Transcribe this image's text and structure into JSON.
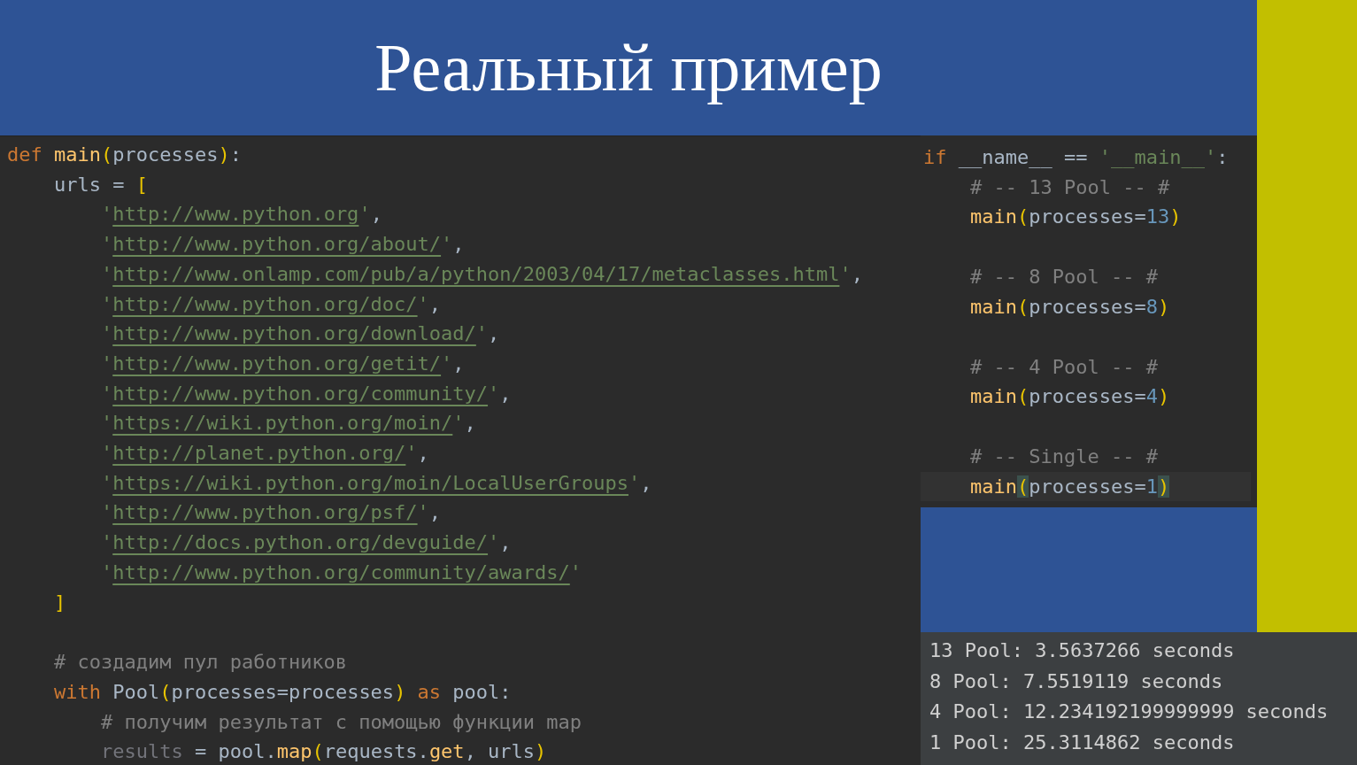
{
  "title": "Реальный пример",
  "main_code": [
    {
      "tokens": [
        {
          "kind": "keyword",
          "text": "def "
        },
        {
          "kind": "func",
          "text": "main"
        },
        {
          "kind": "bracket",
          "text": "("
        },
        {
          "kind": "plain",
          "text": "processes"
        },
        {
          "kind": "bracket",
          "text": ")"
        },
        {
          "kind": "plain",
          "text": ":"
        }
      ]
    },
    {
      "tokens": [
        {
          "kind": "plain",
          "text": "    urls = "
        },
        {
          "kind": "bracket",
          "text": "["
        }
      ]
    },
    {
      "tokens": [
        {
          "kind": "string",
          "text": "        '"
        },
        {
          "kind": "url",
          "text": "http://www.python.org"
        },
        {
          "kind": "string",
          "text": "'"
        },
        {
          "kind": "plain",
          "text": ","
        }
      ]
    },
    {
      "tokens": [
        {
          "kind": "string",
          "text": "        '"
        },
        {
          "kind": "url",
          "text": "http://www.python.org/about/"
        },
        {
          "kind": "string",
          "text": "'"
        },
        {
          "kind": "plain",
          "text": ","
        }
      ]
    },
    {
      "tokens": [
        {
          "kind": "string",
          "text": "        '"
        },
        {
          "kind": "url",
          "text": "http://www.onlamp.com/pub/a/python/2003/04/17/metaclasses.html"
        },
        {
          "kind": "string",
          "text": "'"
        },
        {
          "kind": "plain",
          "text": ","
        }
      ]
    },
    {
      "tokens": [
        {
          "kind": "string",
          "text": "        '"
        },
        {
          "kind": "url",
          "text": "http://www.python.org/doc/"
        },
        {
          "kind": "string",
          "text": "'"
        },
        {
          "kind": "plain",
          "text": ","
        }
      ]
    },
    {
      "tokens": [
        {
          "kind": "string",
          "text": "        '"
        },
        {
          "kind": "url",
          "text": "http://www.python.org/download/"
        },
        {
          "kind": "string",
          "text": "'"
        },
        {
          "kind": "plain",
          "text": ","
        }
      ]
    },
    {
      "tokens": [
        {
          "kind": "string",
          "text": "        '"
        },
        {
          "kind": "url",
          "text": "http://www.python.org/getit/"
        },
        {
          "kind": "string",
          "text": "'"
        },
        {
          "kind": "plain",
          "text": ","
        }
      ]
    },
    {
      "tokens": [
        {
          "kind": "string",
          "text": "        '"
        },
        {
          "kind": "url",
          "text": "http://www.python.org/community/"
        },
        {
          "kind": "string",
          "text": "'"
        },
        {
          "kind": "plain",
          "text": ","
        }
      ]
    },
    {
      "tokens": [
        {
          "kind": "string",
          "text": "        '"
        },
        {
          "kind": "url",
          "text": "https://wiki.python.org/moin/"
        },
        {
          "kind": "string",
          "text": "'"
        },
        {
          "kind": "plain",
          "text": ","
        }
      ]
    },
    {
      "tokens": [
        {
          "kind": "string",
          "text": "        '"
        },
        {
          "kind": "url",
          "text": "http://planet.python.org/"
        },
        {
          "kind": "string",
          "text": "'"
        },
        {
          "kind": "plain",
          "text": ","
        }
      ]
    },
    {
      "tokens": [
        {
          "kind": "string",
          "text": "        '"
        },
        {
          "kind": "url",
          "text": "https://wiki.python.org/moin/LocalUserGroups"
        },
        {
          "kind": "string",
          "text": "'"
        },
        {
          "kind": "plain",
          "text": ","
        }
      ]
    },
    {
      "tokens": [
        {
          "kind": "string",
          "text": "        '"
        },
        {
          "kind": "url",
          "text": "http://www.python.org/psf/"
        },
        {
          "kind": "string",
          "text": "'"
        },
        {
          "kind": "plain",
          "text": ","
        }
      ]
    },
    {
      "tokens": [
        {
          "kind": "string",
          "text": "        '"
        },
        {
          "kind": "url",
          "text": "http://docs.python.org/devguide/"
        },
        {
          "kind": "string",
          "text": "'"
        },
        {
          "kind": "plain",
          "text": ","
        }
      ]
    },
    {
      "tokens": [
        {
          "kind": "string",
          "text": "        '"
        },
        {
          "kind": "url",
          "text": "http://www.python.org/community/awards/"
        },
        {
          "kind": "string",
          "text": "'"
        }
      ]
    },
    {
      "tokens": [
        {
          "kind": "bracket",
          "text": "    ]"
        }
      ]
    },
    {
      "gap_before": true,
      "tokens": [
        {
          "kind": "comment",
          "text": "    # создадим пул работников"
        }
      ]
    },
    {
      "tokens": [
        {
          "kind": "keyword",
          "text": "    with "
        },
        {
          "kind": "plain",
          "text": "Pool"
        },
        {
          "kind": "bracket",
          "text": "("
        },
        {
          "kind": "plain",
          "text": "processes=processes"
        },
        {
          "kind": "bracket",
          "text": ")"
        },
        {
          "kind": "keyword",
          "text": " as "
        },
        {
          "kind": "plain",
          "text": "pool:"
        }
      ]
    },
    {
      "tokens": [
        {
          "kind": "comment",
          "text": "        # получим результат с помощью функции map"
        }
      ]
    },
    {
      "tokens": [
        {
          "kind": "dim",
          "text": "        results"
        },
        {
          "kind": "plain",
          "text": " = pool."
        },
        {
          "kind": "func",
          "text": "map"
        },
        {
          "kind": "bracket",
          "text": "("
        },
        {
          "kind": "plain",
          "text": "requests."
        },
        {
          "kind": "func",
          "text": "get"
        },
        {
          "kind": "plain",
          "text": ", urls"
        },
        {
          "kind": "bracket",
          "text": ")"
        }
      ]
    }
  ],
  "entry_code": [
    {
      "current": false,
      "tokens": [
        {
          "kind": "keyword",
          "text": "if "
        },
        {
          "kind": "plain",
          "text": "__name__ == "
        },
        {
          "kind": "string",
          "text": "'__main__'"
        },
        {
          "kind": "plain",
          "text": ":"
        }
      ]
    },
    {
      "current": false,
      "tokens": [
        {
          "kind": "comment",
          "text": "    # -- 13 Pool -- #"
        }
      ]
    },
    {
      "current": false,
      "tokens": [
        {
          "kind": "func",
          "text": "    main"
        },
        {
          "kind": "bracket",
          "text": "("
        },
        {
          "kind": "plain",
          "text": "processes="
        },
        {
          "kind": "number",
          "text": "13"
        },
        {
          "kind": "bracket",
          "text": ")"
        }
      ]
    },
    {
      "current": false,
      "gap_before": true,
      "tokens": [
        {
          "kind": "comment",
          "text": "    # -- 8 Pool -- #"
        }
      ]
    },
    {
      "current": false,
      "tokens": [
        {
          "kind": "func",
          "text": "    main"
        },
        {
          "kind": "bracket",
          "text": "("
        },
        {
          "kind": "plain",
          "text": "processes="
        },
        {
          "kind": "number",
          "text": "8"
        },
        {
          "kind": "bracket",
          "text": ")"
        }
      ]
    },
    {
      "current": false,
      "gap_before": true,
      "tokens": [
        {
          "kind": "comment",
          "text": "    # -- 4 Pool -- #"
        }
      ]
    },
    {
      "current": false,
      "tokens": [
        {
          "kind": "func",
          "text": "    main"
        },
        {
          "kind": "bracket",
          "text": "("
        },
        {
          "kind": "plain",
          "text": "processes="
        },
        {
          "kind": "number",
          "text": "4"
        },
        {
          "kind": "bracket",
          "text": ")"
        }
      ]
    },
    {
      "current": false,
      "gap_before": true,
      "tokens": [
        {
          "kind": "comment",
          "text": "    # -- Single -- #"
        }
      ]
    },
    {
      "current": true,
      "tokens": [
        {
          "kind": "func",
          "text": "    main"
        },
        {
          "kind": "matched",
          "text": "("
        },
        {
          "kind": "plain",
          "text": "processes="
        },
        {
          "kind": "number",
          "text": "1"
        },
        {
          "kind": "matched",
          "text": ")"
        }
      ]
    }
  ],
  "output": [
    "13 Pool: 3.5637266 seconds",
    "8 Pool: 7.5519119 seconds",
    "4 Pool: 12.234192199999999 seconds",
    "1 Pool: 25.3114862 seconds"
  ]
}
